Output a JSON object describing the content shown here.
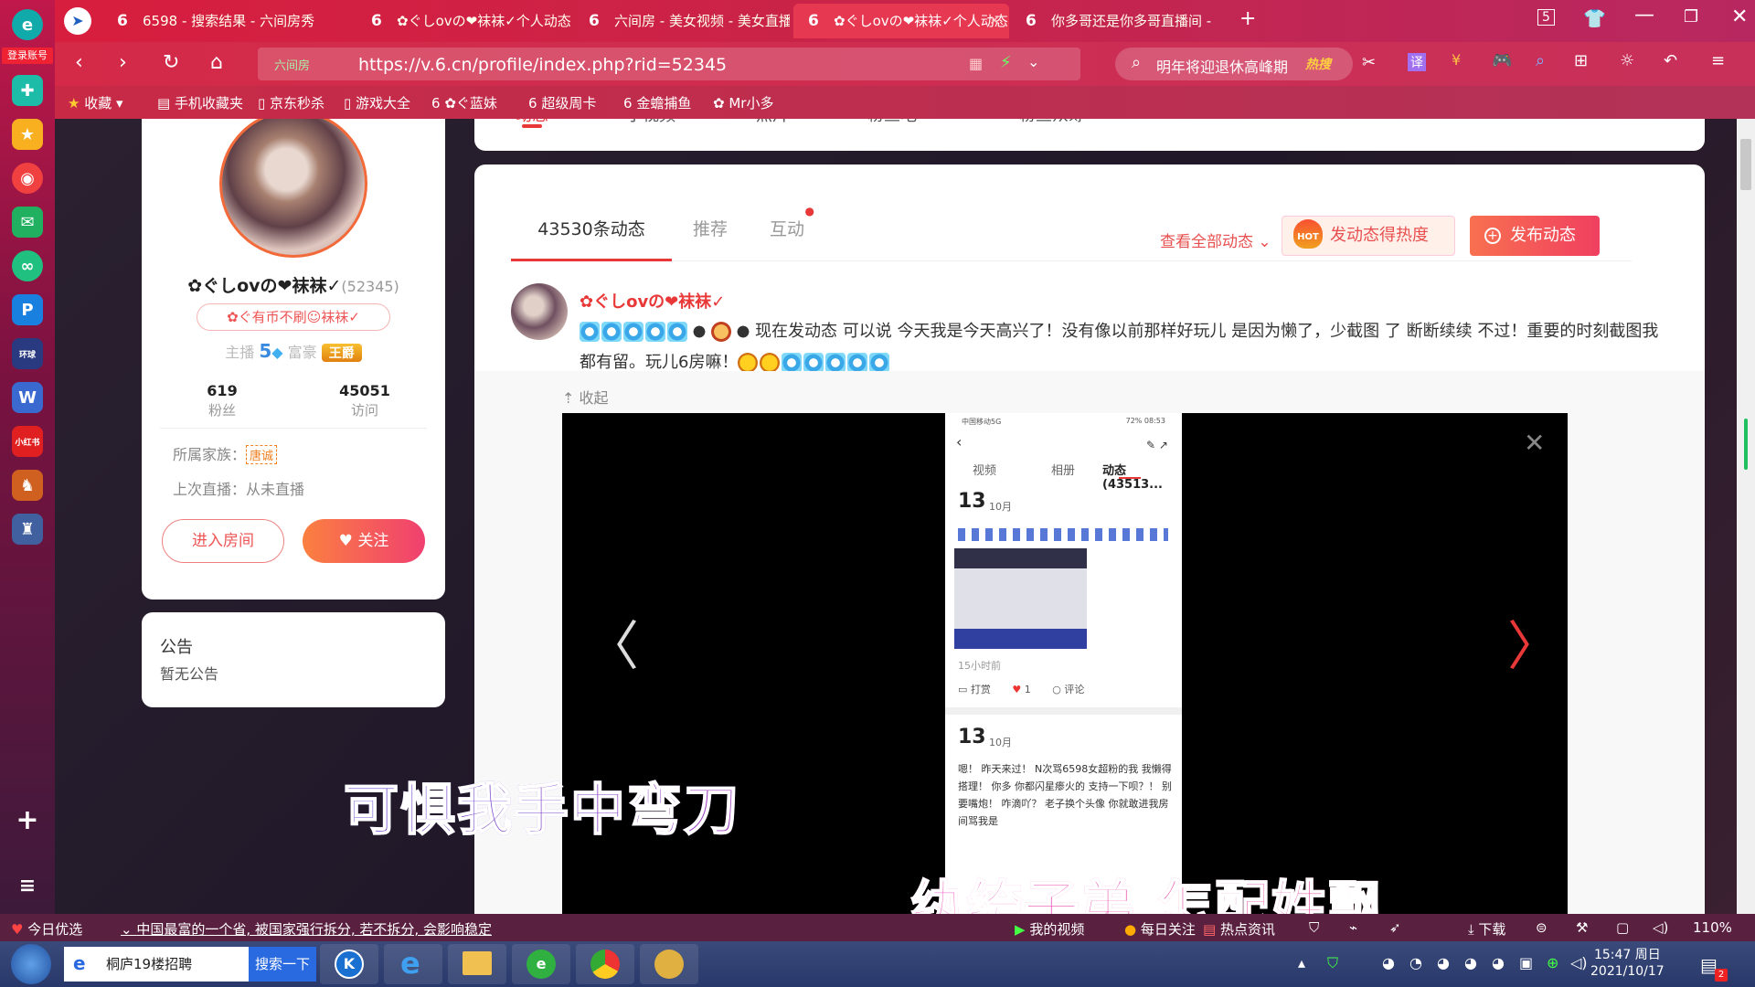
{
  "browser": {
    "login_badge": "登录账号",
    "tabs": [
      {
        "label": "6598 - 搜索结果 - 六间房秀"
      },
      {
        "label": "✿ぐしovの❤袜袜✓个人动态 - "
      },
      {
        "label": "六间房 - 美女视频 - 美女直播"
      },
      {
        "label": "✿ぐしovの❤袜袜✓个人动态 - "
      },
      {
        "label": "你多哥还是你多哥直播间 - "
      }
    ],
    "active_tab": 3,
    "tab_count": "5",
    "url_secure_label": "六间房",
    "url": "https://v.6.cn/profile/index.php?rid=52345",
    "search_text": "明年将迎退休高峰期",
    "search_hot": "热搜",
    "bookmarks": [
      "收藏",
      "手机收藏夹",
      "京东秒杀",
      "游戏大全",
      "✿ぐ蓝妹",
      "超级周卡",
      "金蟾捕鱼",
      "Mr小多"
    ]
  },
  "topnav": {
    "items": [
      "动态",
      "小视频",
      "照片",
      "粉丝吧",
      "粉丝众筹"
    ]
  },
  "profile": {
    "nickname": "✿ぐしovの❤袜袜✓",
    "uid": "(52345)",
    "signature": "✿ぐ有币不刷☺袜袜✓",
    "anchor_label": "主播",
    "anchor_level": "5",
    "rich_label": "富豪",
    "rich_badge": "王爵",
    "fans_count": "619",
    "fans_label": "粉丝",
    "visits_count": "45051",
    "visits_label": "访问",
    "family_label": "所属家族：",
    "family_name": "唐诚",
    "last_live": "上次直播：从未直播",
    "enter_room": "进入房间",
    "follow": "关注"
  },
  "notice": {
    "title": "公告",
    "body": "暂无公告"
  },
  "feed": {
    "tabs": [
      "43530条动态",
      "推荐",
      "互动"
    ],
    "view_all": "查看全部动态",
    "hot_button": "发动态得热度",
    "hot_badge": "HOT",
    "post_button": "发布动态",
    "post": {
      "author": "✿ぐしovの❤袜袜✓",
      "text": "现在发动态 可以说 今天我是今天高兴了！没有像以前那样好玩儿 是因为懒了，少截图 了 断断续续 不过！重要的时刻截图我都有留。玩儿6房嘛！",
      "collapse": "收起"
    },
    "phone": {
      "status_left": "中国移动5G",
      "status_right": "72% 08:53",
      "tabs": [
        "视频",
        "相册",
        "动态(43513..."
      ],
      "day": "13",
      "month": "10月",
      "time_ago": "15小时前",
      "actions": [
        "打赏",
        "1",
        "评论"
      ],
      "day2": "13",
      "month2": "10月",
      "text2": "嗯！ 昨天来过！ N次骂6598女超粉的我 我懒得搭理！ 你多 你都闪星瘆火的 支持一下呗？！ 别要嘴炮！ 咋滴吖？ 老子换个头像 你就敢进我房间骂我是"
    }
  },
  "subtitles": {
    "line1": "可惧我手中弯刀",
    "line2": "纨绔子弟 怎配姓飘"
  },
  "statusbar": {
    "today": "今日优选",
    "news": "中国最富的一个省, 被国家强行拆分, 若不拆分, 会影响稳定",
    "my_video": "我的视频",
    "daily": "每日关注",
    "hot_news": "热点资讯",
    "download": "下载",
    "zoom": "110%"
  },
  "taskbar": {
    "search_text": "桐庐19楼招聘",
    "search_button": "搜索一下",
    "time": "15:47 周日",
    "date": "2021/10/17",
    "notif_count": "2"
  }
}
